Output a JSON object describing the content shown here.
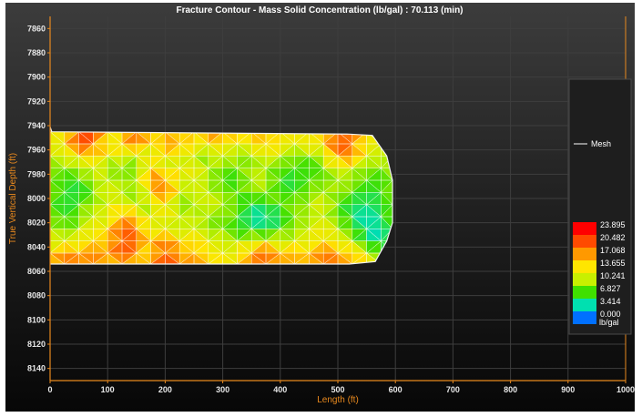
{
  "chart_data": {
    "type": "heatmap",
    "title": "Fracture Contour - Mass Solid Concentration (lb/gal) : 70.113 (min)",
    "xlabel": "Length (ft)",
    "ylabel": "True Vertical Depth (ft)",
    "xlim": [
      0,
      1000
    ],
    "ylim": [
      7850,
      8150
    ],
    "y_inverted": true,
    "x_ticks": [
      0,
      100,
      200,
      300,
      400,
      500,
      600,
      700,
      800,
      900,
      1000
    ],
    "y_ticks": [
      7860,
      7880,
      7900,
      7920,
      7940,
      7960,
      7980,
      8000,
      8020,
      8040,
      8060,
      8080,
      8100,
      8120,
      8140
    ],
    "grid": true,
    "legend": {
      "position": "right",
      "series": [
        "Mesh"
      ]
    },
    "colorbar": {
      "values": [
        "23.895",
        "20.482",
        "17.068",
        "13.655",
        "10.241",
        "6.827",
        "3.414",
        "0.000"
      ],
      "unit": "lb/gal",
      "colors": [
        "#ff0000",
        "#ff4a00",
        "#ff9900",
        "#ffe600",
        "#c8f000",
        "#40e000",
        "#00e0b0",
        "#0070ff"
      ]
    },
    "fracture_outline": [
      [
        0,
        7941
      ],
      [
        3,
        7945
      ],
      [
        520,
        7947
      ],
      [
        560,
        7948
      ],
      [
        585,
        7965
      ],
      [
        595,
        7985
      ],
      [
        595,
        8020
      ],
      [
        585,
        8035
      ],
      [
        565,
        8052
      ],
      [
        520,
        8054
      ],
      [
        0,
        8054
      ]
    ],
    "concentration_grid": {
      "x": [
        0,
        25,
        50,
        75,
        100,
        125,
        150,
        175,
        200,
        225,
        250,
        275,
        300,
        325,
        350,
        375,
        400,
        425,
        450,
        475,
        500,
        525,
        550,
        575,
        595
      ],
      "y": [
        7945,
        7955,
        7965,
        7975,
        7985,
        7995,
        8005,
        8015,
        8025,
        8035,
        8045,
        8054
      ],
      "values": [
        [
          12,
          13,
          19,
          22,
          12,
          13,
          20,
          14,
          15,
          12,
          13,
          17,
          19,
          14,
          16,
          13,
          13,
          14,
          12,
          17,
          18,
          21,
          14,
          13,
          12
        ],
        [
          11,
          14,
          22,
          20,
          12,
          15,
          19,
          13,
          16,
          18,
          13,
          14,
          12,
          11,
          13,
          16,
          13,
          12,
          14,
          13,
          22,
          17,
          13,
          11,
          12
        ],
        [
          10,
          12,
          13,
          14,
          12,
          13,
          10,
          12,
          13,
          11,
          9,
          8,
          12,
          10,
          9,
          12,
          10,
          8,
          9,
          10,
          19,
          18,
          12,
          10,
          11
        ],
        [
          9,
          8,
          10,
          12,
          9,
          7,
          9,
          15,
          8,
          12,
          13,
          10,
          8,
          7,
          10,
          9,
          8,
          7,
          5,
          8,
          11,
          10,
          9,
          8,
          10
        ],
        [
          8,
          7,
          6,
          10,
          11,
          9,
          10,
          16,
          20,
          10,
          12,
          9,
          7,
          6,
          11,
          10,
          6,
          5,
          8,
          7,
          10,
          9,
          7,
          6,
          9
        ],
        [
          9,
          6,
          5,
          8,
          12,
          10,
          8,
          14,
          18,
          9,
          11,
          10,
          9,
          7,
          8,
          9,
          7,
          6,
          8,
          10,
          9,
          8,
          5,
          7,
          8
        ],
        [
          8,
          5,
          7,
          9,
          11,
          12,
          9,
          10,
          16,
          8,
          10,
          12,
          10,
          8,
          5,
          6,
          8,
          9,
          10,
          12,
          7,
          5,
          4,
          6,
          8
        ],
        [
          9,
          6,
          8,
          12,
          10,
          18,
          15,
          10,
          12,
          9,
          11,
          8,
          9,
          7,
          4,
          3,
          5,
          8,
          9,
          11,
          8,
          5,
          3,
          5,
          8
        ],
        [
          10,
          8,
          9,
          13,
          12,
          20,
          17,
          12,
          13,
          10,
          12,
          9,
          8,
          6,
          5,
          5,
          7,
          9,
          11,
          13,
          10,
          7,
          3,
          4,
          7
        ],
        [
          11,
          12,
          13,
          15,
          16,
          22,
          19,
          14,
          18,
          13,
          14,
          12,
          11,
          10,
          10,
          12,
          10,
          11,
          12,
          14,
          12,
          10,
          5,
          3,
          6
        ],
        [
          12,
          18,
          14,
          19,
          14,
          21,
          16,
          13,
          22,
          15,
          16,
          13,
          12,
          12,
          17,
          20,
          15,
          16,
          14,
          19,
          16,
          14,
          12,
          6,
          8
        ],
        [
          13,
          22,
          17,
          20,
          15,
          18,
          14,
          16,
          20,
          17,
          18,
          15,
          14,
          13,
          18,
          19,
          16,
          17,
          15,
          20,
          18,
          16,
          14,
          10,
          10
        ]
      ]
    }
  }
}
